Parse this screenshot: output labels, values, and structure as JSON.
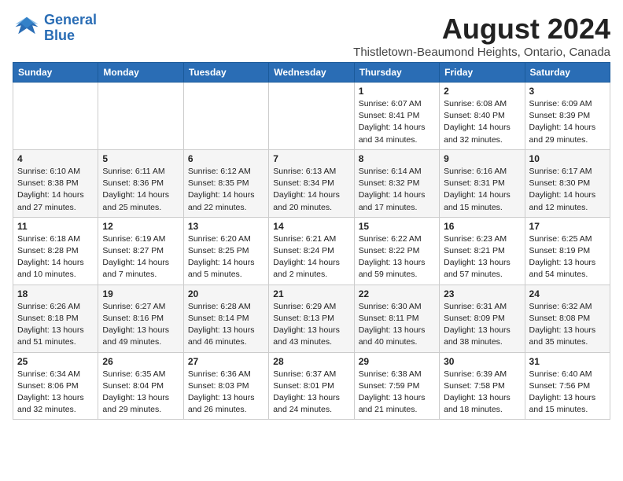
{
  "header": {
    "logo_line1": "General",
    "logo_line2": "Blue",
    "title": "August 2024",
    "subtitle": "Thistletown-Beaumond Heights, Ontario, Canada"
  },
  "weekdays": [
    "Sunday",
    "Monday",
    "Tuesday",
    "Wednesday",
    "Thursday",
    "Friday",
    "Saturday"
  ],
  "weeks": [
    [
      {
        "day": "",
        "info": ""
      },
      {
        "day": "",
        "info": ""
      },
      {
        "day": "",
        "info": ""
      },
      {
        "day": "",
        "info": ""
      },
      {
        "day": "1",
        "info": "Sunrise: 6:07 AM\nSunset: 8:41 PM\nDaylight: 14 hours\nand 34 minutes."
      },
      {
        "day": "2",
        "info": "Sunrise: 6:08 AM\nSunset: 8:40 PM\nDaylight: 14 hours\nand 32 minutes."
      },
      {
        "day": "3",
        "info": "Sunrise: 6:09 AM\nSunset: 8:39 PM\nDaylight: 14 hours\nand 29 minutes."
      }
    ],
    [
      {
        "day": "4",
        "info": "Sunrise: 6:10 AM\nSunset: 8:38 PM\nDaylight: 14 hours\nand 27 minutes."
      },
      {
        "day": "5",
        "info": "Sunrise: 6:11 AM\nSunset: 8:36 PM\nDaylight: 14 hours\nand 25 minutes."
      },
      {
        "day": "6",
        "info": "Sunrise: 6:12 AM\nSunset: 8:35 PM\nDaylight: 14 hours\nand 22 minutes."
      },
      {
        "day": "7",
        "info": "Sunrise: 6:13 AM\nSunset: 8:34 PM\nDaylight: 14 hours\nand 20 minutes."
      },
      {
        "day": "8",
        "info": "Sunrise: 6:14 AM\nSunset: 8:32 PM\nDaylight: 14 hours\nand 17 minutes."
      },
      {
        "day": "9",
        "info": "Sunrise: 6:16 AM\nSunset: 8:31 PM\nDaylight: 14 hours\nand 15 minutes."
      },
      {
        "day": "10",
        "info": "Sunrise: 6:17 AM\nSunset: 8:30 PM\nDaylight: 14 hours\nand 12 minutes."
      }
    ],
    [
      {
        "day": "11",
        "info": "Sunrise: 6:18 AM\nSunset: 8:28 PM\nDaylight: 14 hours\nand 10 minutes."
      },
      {
        "day": "12",
        "info": "Sunrise: 6:19 AM\nSunset: 8:27 PM\nDaylight: 14 hours\nand 7 minutes."
      },
      {
        "day": "13",
        "info": "Sunrise: 6:20 AM\nSunset: 8:25 PM\nDaylight: 14 hours\nand 5 minutes."
      },
      {
        "day": "14",
        "info": "Sunrise: 6:21 AM\nSunset: 8:24 PM\nDaylight: 14 hours\nand 2 minutes."
      },
      {
        "day": "15",
        "info": "Sunrise: 6:22 AM\nSunset: 8:22 PM\nDaylight: 13 hours\nand 59 minutes."
      },
      {
        "day": "16",
        "info": "Sunrise: 6:23 AM\nSunset: 8:21 PM\nDaylight: 13 hours\nand 57 minutes."
      },
      {
        "day": "17",
        "info": "Sunrise: 6:25 AM\nSunset: 8:19 PM\nDaylight: 13 hours\nand 54 minutes."
      }
    ],
    [
      {
        "day": "18",
        "info": "Sunrise: 6:26 AM\nSunset: 8:18 PM\nDaylight: 13 hours\nand 51 minutes."
      },
      {
        "day": "19",
        "info": "Sunrise: 6:27 AM\nSunset: 8:16 PM\nDaylight: 13 hours\nand 49 minutes."
      },
      {
        "day": "20",
        "info": "Sunrise: 6:28 AM\nSunset: 8:14 PM\nDaylight: 13 hours\nand 46 minutes."
      },
      {
        "day": "21",
        "info": "Sunrise: 6:29 AM\nSunset: 8:13 PM\nDaylight: 13 hours\nand 43 minutes."
      },
      {
        "day": "22",
        "info": "Sunrise: 6:30 AM\nSunset: 8:11 PM\nDaylight: 13 hours\nand 40 minutes."
      },
      {
        "day": "23",
        "info": "Sunrise: 6:31 AM\nSunset: 8:09 PM\nDaylight: 13 hours\nand 38 minutes."
      },
      {
        "day": "24",
        "info": "Sunrise: 6:32 AM\nSunset: 8:08 PM\nDaylight: 13 hours\nand 35 minutes."
      }
    ],
    [
      {
        "day": "25",
        "info": "Sunrise: 6:34 AM\nSunset: 8:06 PM\nDaylight: 13 hours\nand 32 minutes."
      },
      {
        "day": "26",
        "info": "Sunrise: 6:35 AM\nSunset: 8:04 PM\nDaylight: 13 hours\nand 29 minutes."
      },
      {
        "day": "27",
        "info": "Sunrise: 6:36 AM\nSunset: 8:03 PM\nDaylight: 13 hours\nand 26 minutes."
      },
      {
        "day": "28",
        "info": "Sunrise: 6:37 AM\nSunset: 8:01 PM\nDaylight: 13 hours\nand 24 minutes."
      },
      {
        "day": "29",
        "info": "Sunrise: 6:38 AM\nSunset: 7:59 PM\nDaylight: 13 hours\nand 21 minutes."
      },
      {
        "day": "30",
        "info": "Sunrise: 6:39 AM\nSunset: 7:58 PM\nDaylight: 13 hours\nand 18 minutes."
      },
      {
        "day": "31",
        "info": "Sunrise: 6:40 AM\nSunset: 7:56 PM\nDaylight: 13 hours\nand 15 minutes."
      }
    ]
  ]
}
